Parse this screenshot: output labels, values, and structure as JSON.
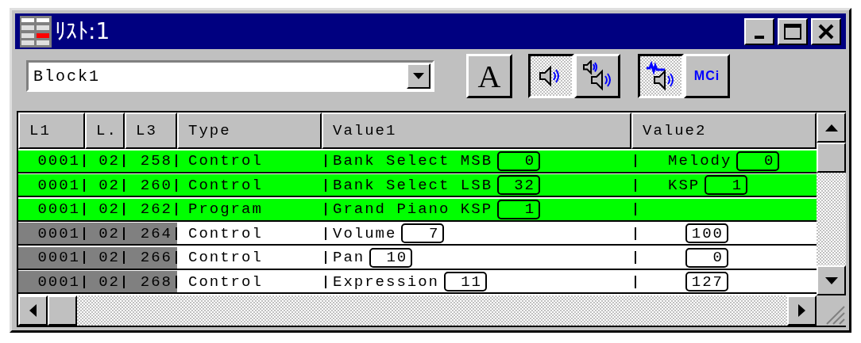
{
  "window": {
    "title": "ﾘｽﾄ:1"
  },
  "toolbar": {
    "block": {
      "value": "Block1"
    },
    "buttons": [
      {
        "kind": "font",
        "label": "A",
        "pressed": false
      },
      {
        "kind": "speaker",
        "pressed": true
      },
      {
        "kind": "speakers",
        "pressed": false
      },
      {
        "kind": "wave-speaker",
        "pressed": true
      },
      {
        "kind": "mci",
        "label": "MCi",
        "pressed": false
      }
    ]
  },
  "table": {
    "columns": [
      "L1",
      "L.",
      "L3",
      "Type",
      "Value1",
      "Value2"
    ],
    "rows": [
      {
        "l1": "0001",
        "l2": "02",
        "l3": "258",
        "type": "Control",
        "value1": {
          "label": "Bank Select MSB",
          "value": "0"
        },
        "value2": {
          "label": "Melody",
          "value": "0"
        },
        "selected": true
      },
      {
        "l1": "0001",
        "l2": "02",
        "l3": "260",
        "type": "Control",
        "value1": {
          "label": "Bank Select LSB",
          "value": "32"
        },
        "value2": {
          "label": "KSP",
          "value": "1"
        },
        "selected": true
      },
      {
        "l1": "0001",
        "l2": "02",
        "l3": "262",
        "type": "Program",
        "value1": {
          "label": "Grand Piano KSP",
          "value": "1"
        },
        "selected": true
      },
      {
        "l1": "0001",
        "l2": "02",
        "l3": "264",
        "type": "Control",
        "value1": {
          "label": "Volume",
          "value": "7"
        },
        "value2": {
          "value": "100"
        },
        "selected": false
      },
      {
        "l1": "0001",
        "l2": "02",
        "l3": "266",
        "type": "Control",
        "value1": {
          "label": "Pan",
          "value": "10"
        },
        "value2": {
          "value": "0"
        },
        "selected": false
      },
      {
        "l1": "0001",
        "l2": "02",
        "l3": "268",
        "type": "Control",
        "value1": {
          "label": "Expression",
          "value": "11"
        },
        "value2": {
          "value": "127"
        },
        "selected": false
      }
    ]
  }
}
